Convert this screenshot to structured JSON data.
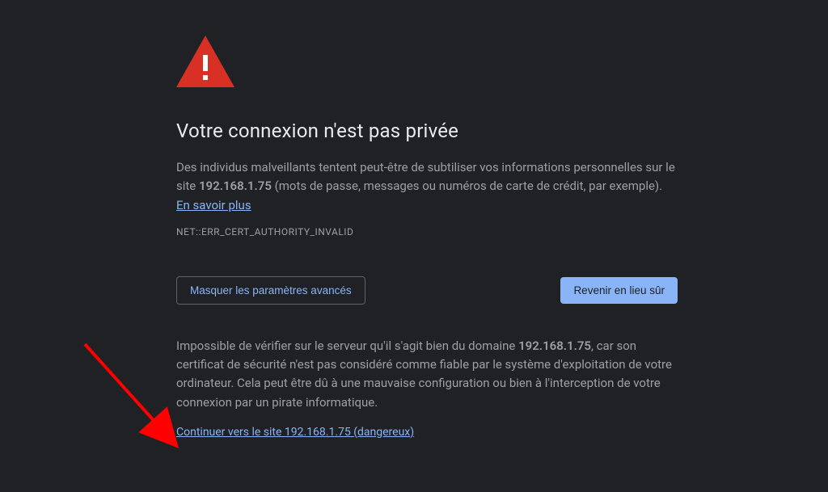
{
  "title": "Votre connexion n'est pas privée",
  "para1_prefix": "Des individus malveillants tentent peut-être de subtiliser vos informations personnelles sur le site ",
  "domain_bold": "192.168.1.75",
  "para1_suffix": " (mots de passe, messages ou numéros de carte de crédit, par exemple). ",
  "learn_more": "En savoir plus",
  "error_code": "NET::ERR_CERT_AUTHORITY_INVALID",
  "buttons": {
    "hide_advanced": "Masquer les paramètres avancés",
    "back_safe": "Revenir en lieu sûr"
  },
  "advanced_prefix": "Impossible de vérifier sur le serveur qu'il s'agit bien du domaine ",
  "advanced_domain": "192.168.1.75",
  "advanced_suffix": ", car son certificat de sécurité n'est pas considéré comme fiable par le système d'exploitation de votre ordinateur. Cela peut être dû à une mauvaise configuration ou bien à l'interception de votre connexion par un pirate informatique.",
  "proceed_link": "Continuer vers le site 192.168.1.75 (dangereux)",
  "colors": {
    "danger": "#d93025",
    "link": "#8ab4f8"
  }
}
